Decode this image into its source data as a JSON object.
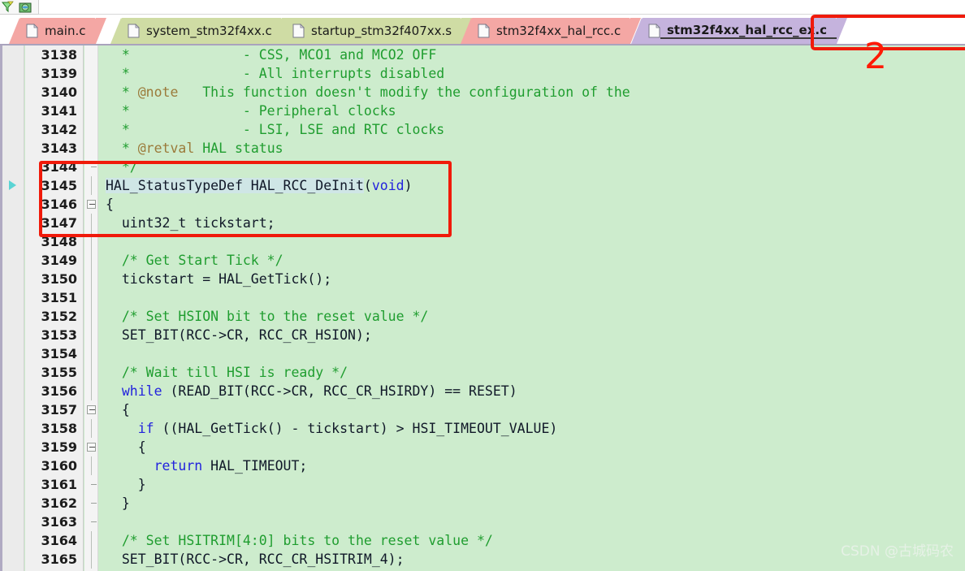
{
  "toolbar": {
    "icons": [
      {
        "name": "filter-icon",
        "label": "Filter"
      },
      {
        "name": "globe-package-icon",
        "label": "Browse"
      }
    ]
  },
  "tabs": [
    {
      "label": "main.c",
      "color": "pink",
      "active": false,
      "icon": "file-icon"
    },
    {
      "label": "system_stm32f4xx.c",
      "color": "green",
      "active": false,
      "icon": "file-icon"
    },
    {
      "label": "startup_stm32f407xx.s",
      "color": "green",
      "active": false,
      "icon": "file-icon"
    },
    {
      "label": "stm32f4xx_hal_rcc.c",
      "color": "pink",
      "active": false,
      "icon": "file-icon"
    },
    {
      "label": "stm32f4xx_hal_rcc_ex.c",
      "color": "purple",
      "active": true,
      "icon": "file-icon"
    }
  ],
  "editor": {
    "first_line": 3138,
    "lines": [
      {
        "n": 3138,
        "fold": "none",
        "marker": false,
        "hl": false,
        "tokens": [
          {
            "t": "  * ",
            "c": "cmt"
          },
          {
            "t": "             - CSS, MCO1 and MCO2 OFF",
            "c": "cmt"
          }
        ]
      },
      {
        "n": 3139,
        "fold": "none",
        "marker": false,
        "hl": false,
        "tokens": [
          {
            "t": "  *              - All interrupts disabled",
            "c": "cmt"
          }
        ]
      },
      {
        "n": 3140,
        "fold": "none",
        "marker": false,
        "hl": false,
        "tokens": [
          {
            "t": "  * ",
            "c": "cmt"
          },
          {
            "t": "@note",
            "c": "tag"
          },
          {
            "t": "   This function doesn't modify the configuration of the",
            "c": "cmt"
          }
        ]
      },
      {
        "n": 3141,
        "fold": "none",
        "marker": false,
        "hl": false,
        "tokens": [
          {
            "t": "  *              - Peripheral clocks",
            "c": "cmt"
          }
        ]
      },
      {
        "n": 3142,
        "fold": "none",
        "marker": false,
        "hl": false,
        "tokens": [
          {
            "t": "  *              - LSI, LSE and RTC clocks",
            "c": "cmt"
          }
        ]
      },
      {
        "n": 3143,
        "fold": "none",
        "marker": false,
        "hl": false,
        "tokens": [
          {
            "t": "  * ",
            "c": "cmt"
          },
          {
            "t": "@retval",
            "c": "tag"
          },
          {
            "t": " HAL status",
            "c": "cmt"
          }
        ]
      },
      {
        "n": 3144,
        "fold": "tick",
        "marker": false,
        "hl": false,
        "tokens": [
          {
            "t": "  */",
            "c": "cmt"
          }
        ]
      },
      {
        "n": 3145,
        "fold": "line",
        "marker": true,
        "hl": false,
        "tokens": [
          {
            "t": "HAL_StatusTypeDef HAL_RCC_DeInit",
            "c": "hl"
          },
          {
            "t": "(",
            "c": ""
          },
          {
            "t": "void",
            "c": "kw"
          },
          {
            "t": ")",
            "c": ""
          }
        ]
      },
      {
        "n": 3146,
        "fold": "box",
        "marker": false,
        "hl": false,
        "tokens": [
          {
            "t": "{",
            "c": ""
          }
        ]
      },
      {
        "n": 3147,
        "fold": "line",
        "marker": false,
        "hl": false,
        "tokens": [
          {
            "t": "  uint32_t tickstart;",
            "c": ""
          }
        ]
      },
      {
        "n": 3148,
        "fold": "line",
        "marker": false,
        "hl": false,
        "tokens": [
          {
            "t": "",
            "c": ""
          }
        ]
      },
      {
        "n": 3149,
        "fold": "line",
        "marker": false,
        "hl": false,
        "tokens": [
          {
            "t": "  /* Get Start Tick */",
            "c": "cmt"
          }
        ]
      },
      {
        "n": 3150,
        "fold": "line",
        "marker": false,
        "hl": false,
        "tokens": [
          {
            "t": "  tickstart = HAL_GetTick();",
            "c": ""
          }
        ]
      },
      {
        "n": 3151,
        "fold": "line",
        "marker": false,
        "hl": false,
        "tokens": [
          {
            "t": "",
            "c": ""
          }
        ]
      },
      {
        "n": 3152,
        "fold": "line",
        "marker": false,
        "hl": false,
        "tokens": [
          {
            "t": "  /* Set HSION bit to the reset value */",
            "c": "cmt"
          }
        ]
      },
      {
        "n": 3153,
        "fold": "line",
        "marker": false,
        "hl": false,
        "tokens": [
          {
            "t": "  SET_BIT(RCC->CR, RCC_CR_HSION);",
            "c": ""
          }
        ]
      },
      {
        "n": 3154,
        "fold": "line",
        "marker": false,
        "hl": false,
        "tokens": [
          {
            "t": "",
            "c": ""
          }
        ]
      },
      {
        "n": 3155,
        "fold": "line",
        "marker": false,
        "hl": false,
        "tokens": [
          {
            "t": "  /* Wait till HSI is ready */",
            "c": "cmt"
          }
        ]
      },
      {
        "n": 3156,
        "fold": "line",
        "marker": false,
        "hl": false,
        "tokens": [
          {
            "t": "  ",
            "c": ""
          },
          {
            "t": "while",
            "c": "kw"
          },
          {
            "t": " (READ_BIT(RCC->CR, RCC_CR_HSIRDY) == RESET)",
            "c": ""
          }
        ]
      },
      {
        "n": 3157,
        "fold": "box",
        "marker": false,
        "hl": false,
        "tokens": [
          {
            "t": "  {",
            "c": ""
          }
        ]
      },
      {
        "n": 3158,
        "fold": "line",
        "marker": false,
        "hl": false,
        "tokens": [
          {
            "t": "    ",
            "c": ""
          },
          {
            "t": "if",
            "c": "kw"
          },
          {
            "t": " ((HAL_GetTick() - tickstart) > HSI_TIMEOUT_VALUE)",
            "c": ""
          }
        ]
      },
      {
        "n": 3159,
        "fold": "box",
        "marker": false,
        "hl": false,
        "tokens": [
          {
            "t": "    {",
            "c": ""
          }
        ]
      },
      {
        "n": 3160,
        "fold": "line",
        "marker": false,
        "hl": false,
        "tokens": [
          {
            "t": "      ",
            "c": ""
          },
          {
            "t": "return",
            "c": "kw"
          },
          {
            "t": " HAL_TIMEOUT;",
            "c": ""
          }
        ]
      },
      {
        "n": 3161,
        "fold": "tick",
        "marker": false,
        "hl": false,
        "tokens": [
          {
            "t": "    }",
            "c": ""
          }
        ]
      },
      {
        "n": 3162,
        "fold": "tick",
        "marker": false,
        "hl": false,
        "tokens": [
          {
            "t": "  }",
            "c": ""
          }
        ]
      },
      {
        "n": 3163,
        "fold": "tick",
        "marker": false,
        "hl": false,
        "tokens": [
          {
            "t": "",
            "c": ""
          }
        ]
      },
      {
        "n": 3164,
        "fold": "line",
        "marker": false,
        "hl": false,
        "tokens": [
          {
            "t": "  /* Set HSITRIM[4:0] bits to the reset value */",
            "c": "cmt"
          }
        ]
      },
      {
        "n": 3165,
        "fold": "line",
        "marker": false,
        "hl": false,
        "tokens": [
          {
            "t": "  SET_BIT(RCC->CR, RCC_CR_HSITRIM_4);",
            "c": ""
          }
        ]
      }
    ]
  },
  "annotations": {
    "step_number": "2",
    "box_color": "#f01a0a"
  },
  "watermark": "CSDN @古城码农",
  "colors": {
    "code_background": "#cdeccd",
    "comment": "#1f9d2f",
    "keyword": "#2222dd",
    "doc_tag": "#9b7a3a",
    "active_tab": "#c5b3dd",
    "pink_tab": "#f4a7a4",
    "green_tab": "#cfdca4",
    "annotation_red": "#f01a0a"
  }
}
